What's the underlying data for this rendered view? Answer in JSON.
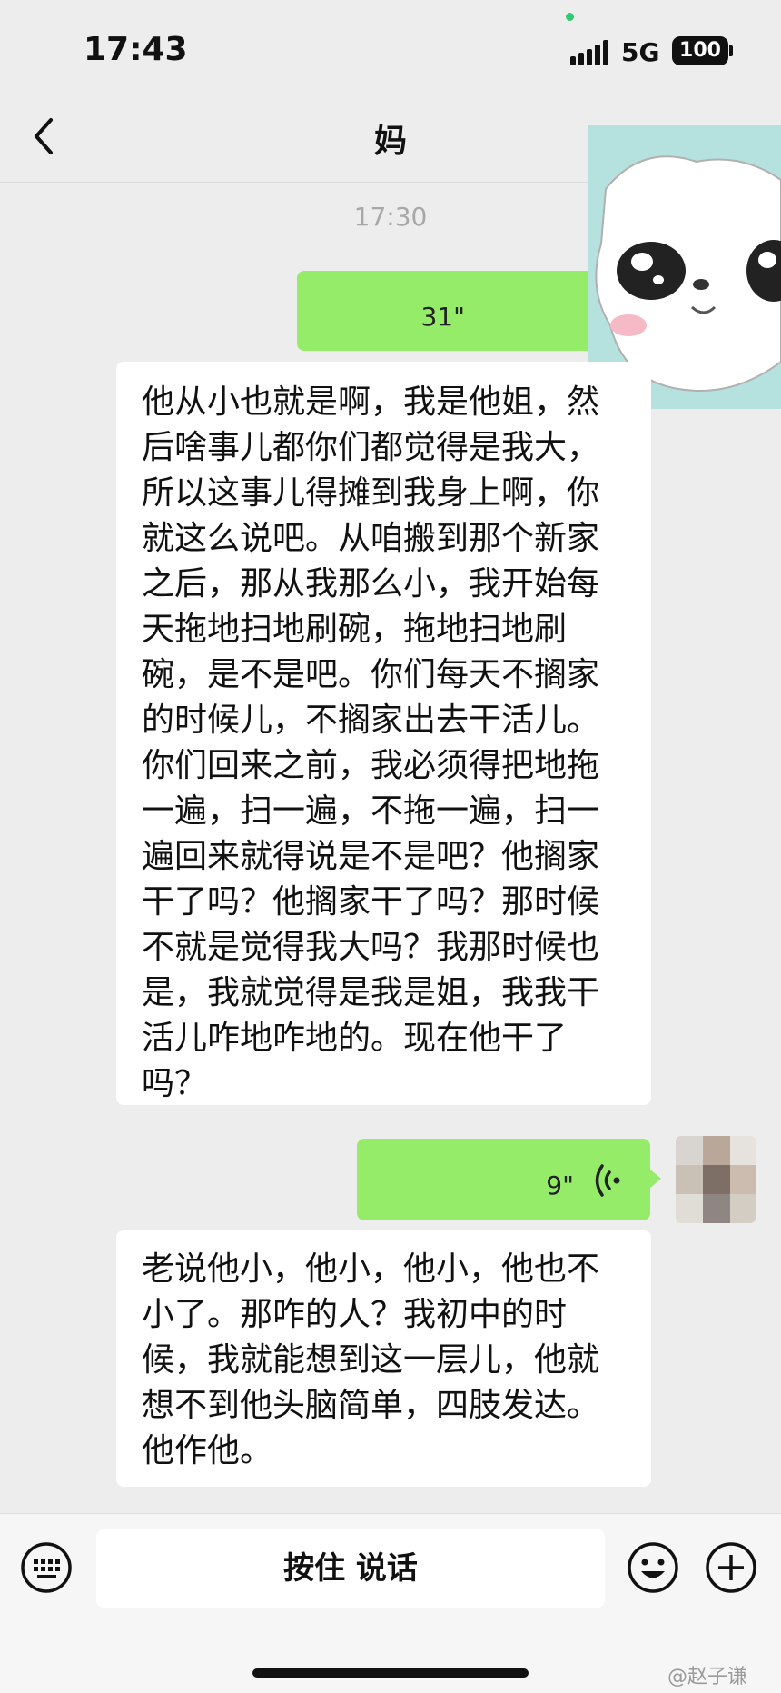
{
  "status_bar": {
    "time": "17:43",
    "network": "5G",
    "battery": "100"
  },
  "header": {
    "title": "妈"
  },
  "chat": {
    "timestamp": "17:30",
    "messages": [
      {
        "side": "right",
        "type": "voice",
        "duration": "31\""
      },
      {
        "side": "left",
        "type": "text",
        "text": "他从小也就是啊，我是他姐，然后啥事儿都你们都觉得是我大，所以这事儿得摊到我身上啊，你就这么说吧。从咱搬到那个新家之后，那从我那么小，我开始每天拖地扫地刷碗，拖地扫地刷碗，是不是吧。你们每天不搁家的时候儿，不搁家出去干活儿。你们回来之前，我必须得把地拖一遍，扫一遍，不拖一遍，扫一遍回来就得说是不是吧？他搁家干了吗？他搁家干了吗？那时候不就是觉得我大吗？我那时候也是，我就觉得是我是姐，我我干活儿咋地咋地的。现在他干了吗？"
      },
      {
        "side": "right",
        "type": "voice",
        "duration": "9\""
      },
      {
        "side": "left",
        "type": "text",
        "text": "老说他小，他小，他小，他也不小了。那咋的人？我初中的时候，我就能想到这一层儿，他就想不到他头脑简单，四肢发达。他作他。"
      }
    ]
  },
  "input_bar": {
    "hold_to_talk": "按住 说话"
  },
  "watermark": "@赵子谦",
  "colors": {
    "background": "#ededed",
    "self_bubble": "#95ec69",
    "other_bubble": "#ffffff"
  }
}
